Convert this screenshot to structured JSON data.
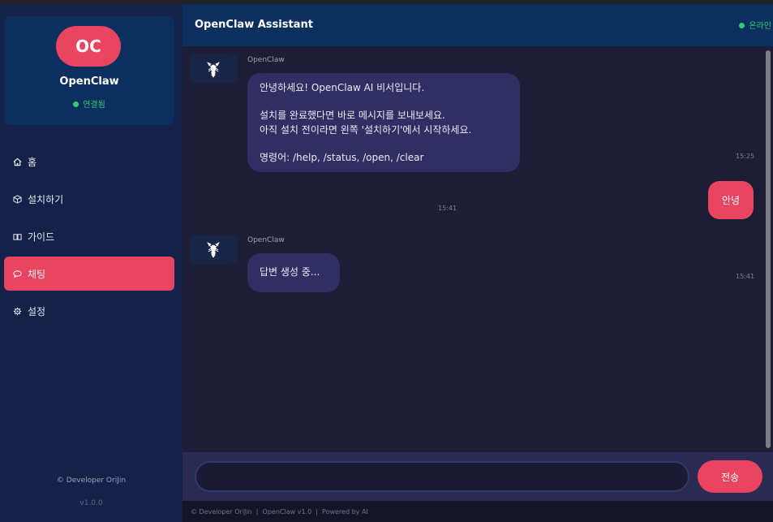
{
  "sidebar": {
    "avatar_initials": "OC",
    "name": "OpenClaw",
    "status": "연결됨",
    "items": [
      {
        "label": "홈",
        "icon": "home-icon"
      },
      {
        "label": "설치하기",
        "icon": "package-icon"
      },
      {
        "label": "가이드",
        "icon": "book-icon"
      },
      {
        "label": "채팅",
        "icon": "chat-bubble-icon",
        "active": true
      },
      {
        "label": "설정",
        "icon": "gear-icon"
      }
    ],
    "copyright": "© Developer OriJin",
    "version": "v1.0.0"
  },
  "header": {
    "title": "OpenClaw Assistant",
    "status": "온라인"
  },
  "messages": [
    {
      "role": "bot",
      "sender": "OpenClaw",
      "avatar_icon": "lobster-icon",
      "lines": [
        "안녕하세요! OpenClaw AI 비서입니다.",
        "",
        "설치를 완료했다면 바로 메시지를 보내보세요.",
        "아직 설치 전이라면 왼쪽 '설치하기'에서 시작하세요.",
        "",
        "명령어: /help, /status, /open, /clear"
      ],
      "time": "15:25"
    },
    {
      "role": "user",
      "text": "안녕",
      "time": "15:41"
    },
    {
      "role": "bot",
      "sender": "OpenClaw",
      "avatar_icon": "lobster-icon",
      "text": "답변 생성 중...",
      "time": "15:41"
    }
  ],
  "composer": {
    "value": "",
    "placeholder": "",
    "send_label": "전송"
  },
  "footer": {
    "text": "© Developer OriJin  |  OpenClaw v1.0  |  Powered by AI"
  },
  "colors": {
    "accent": "#e94560",
    "online": "#2ecc71",
    "sidebar_bg": "#14224a",
    "header_bg": "#0d2f5e",
    "chat_bg": "#1e1d36",
    "bot_bubble": "#302e62"
  }
}
